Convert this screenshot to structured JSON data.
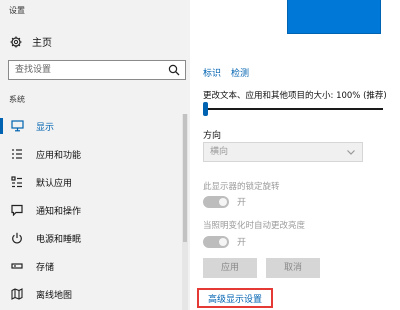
{
  "window": {
    "title": "设置"
  },
  "sidebar": {
    "home_label": "主页",
    "search_placeholder": "查找设置",
    "section_label": "系统",
    "items": [
      {
        "label": "显示",
        "icon": "monitor-icon",
        "active": true
      },
      {
        "label": "应用和功能",
        "icon": "apps-list-icon",
        "active": false
      },
      {
        "label": "默认应用",
        "icon": "default-apps-icon",
        "active": false
      },
      {
        "label": "通知和操作",
        "icon": "notification-icon",
        "active": false
      },
      {
        "label": "电源和睡眠",
        "icon": "power-icon",
        "active": false
      },
      {
        "label": "存储",
        "icon": "storage-icon",
        "active": false
      },
      {
        "label": "离线地图",
        "icon": "map-icon",
        "active": false
      }
    ]
  },
  "main": {
    "links": {
      "identify": "标识",
      "detect": "检测"
    },
    "scale_label": "更改文本、应用和其他项目的大小: 100% (推荐)",
    "scale_value_fraction": 0.0,
    "orientation": {
      "label": "方向",
      "value": "横向"
    },
    "rotation_lock": {
      "label": "此显示器的锁定旋转",
      "state": "开"
    },
    "auto_brightness": {
      "label": "当照明变化时自动更改亮度",
      "state": "开"
    },
    "apply_label": "应用",
    "cancel_label": "取消",
    "advanced_link": "高级显示设置"
  },
  "colors": {
    "accent": "#0063b1",
    "highlight_box": "#e53935",
    "monitor": "#0078d7"
  }
}
